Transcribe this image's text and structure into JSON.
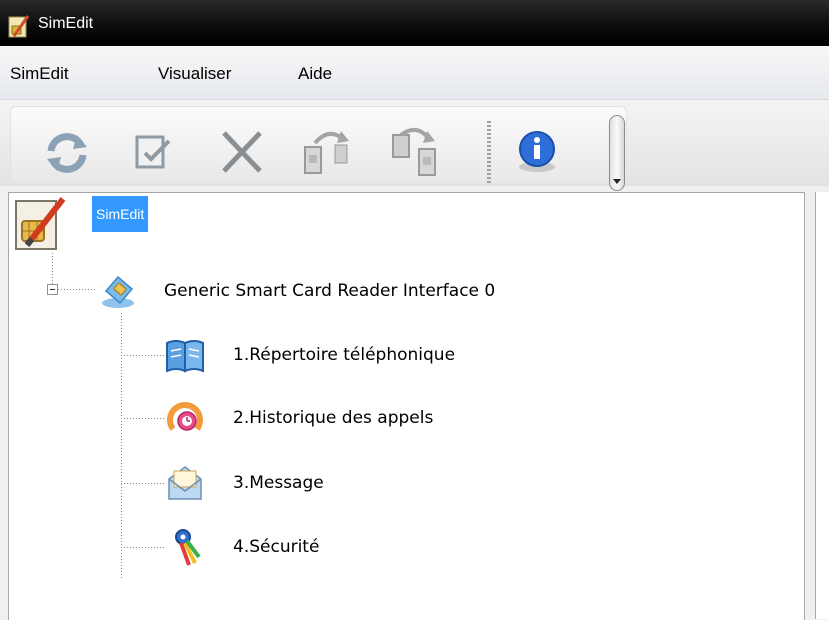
{
  "window": {
    "title": "SimEdit"
  },
  "menu": {
    "items": [
      "SimEdit",
      "Visualiser",
      "Aide"
    ]
  },
  "toolbar": {
    "buttons": [
      "refresh-icon",
      "edit-icon",
      "delete-icon",
      "copy-to-card-icon",
      "copy-to-pc-icon",
      "info-icon"
    ]
  },
  "tree": {
    "root": {
      "label": "SimEdit",
      "icon": "simedit-icon",
      "selected": true
    },
    "reader": {
      "label": "Generic Smart Card Reader Interface 0",
      "icon": "sim-card-icon",
      "expanded": true
    },
    "children": [
      {
        "label": "1.Répertoire téléphonique",
        "icon": "phonebook-icon"
      },
      {
        "label": "2.Historique des appels",
        "icon": "call-history-icon"
      },
      {
        "label": "3.Message",
        "icon": "message-icon"
      },
      {
        "label": "4.Sécurité",
        "icon": "security-icon"
      }
    ]
  },
  "colors": {
    "selection": "#3399ff",
    "titlebar": "#000000"
  }
}
